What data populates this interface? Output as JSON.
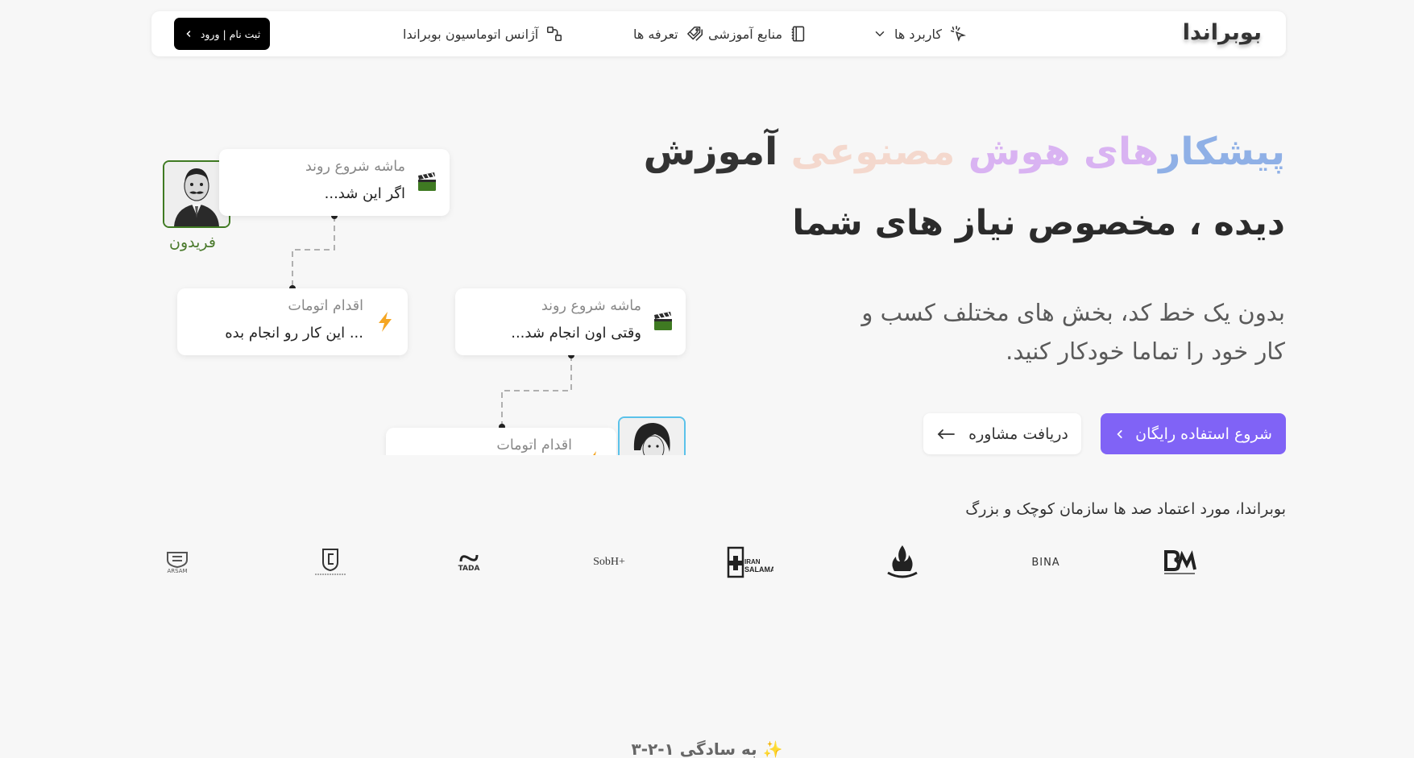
{
  "navbar": {
    "brand": "بوبراندا",
    "items": [
      {
        "label": "کاربرد ها",
        "icon": "sparkle-cursor-icon",
        "has_dropdown": true
      },
      {
        "label": "منابع آموزشی",
        "icon": "notebook-icon",
        "has_dropdown": true
      },
      {
        "label": "تعرفه ها",
        "icon": "price-tags-icon",
        "has_dropdown": false
      },
      {
        "label": "آژانس اتوماسیون بوبراندا",
        "icon": "workflow-nodes-icon",
        "has_dropdown": false
      }
    ],
    "login_label": "ثبت نام | ورود"
  },
  "hero": {
    "title_parts": [
      "پیشکار",
      "های هوش",
      " مصنوعی",
      " آموزش"
    ],
    "title_line2": "دیده ، مخصوص نیاز های شما",
    "description": "بدون یک خط کد، بخش های مختلف کسب و کار خود را تماما خودکار کنید.",
    "primary_button": "شروع استفاده رایگان",
    "secondary_button": "دریافت مشاوره"
  },
  "diagram": {
    "avatar1_name": "فریدون",
    "cards": [
      {
        "label": "ماشه شروع روند",
        "text": "اگر این شد...",
        "icon": "clapperboard-icon"
      },
      {
        "label": "اقدام اتومات",
        "text": "... این کار رو انجام بده",
        "icon": "lightning-icon"
      },
      {
        "label": "ماشه شروع روند",
        "text": "وقتی اون انجام شد...",
        "icon": "clapperboard-icon"
      },
      {
        "label": "اقدام اتومات",
        "text": "",
        "icon": "lightning-icon"
      }
    ]
  },
  "trusted": {
    "heading": "بوبراندا، مورد اعتماد صد ها سازمان کوچک و بزرگ",
    "logos": [
      "BINA",
      "SobH+",
      "TADA",
      "ARSAM"
    ]
  },
  "footer_teaser": "✨ به سادگی ۱-۲-۳",
  "colors": {
    "primary": "#8063f6",
    "background": "#f7f7f7",
    "avatar_green_border": "#3f7a22",
    "avatar_blue_border": "#5bc2ea",
    "lightning": "#f5a623"
  }
}
